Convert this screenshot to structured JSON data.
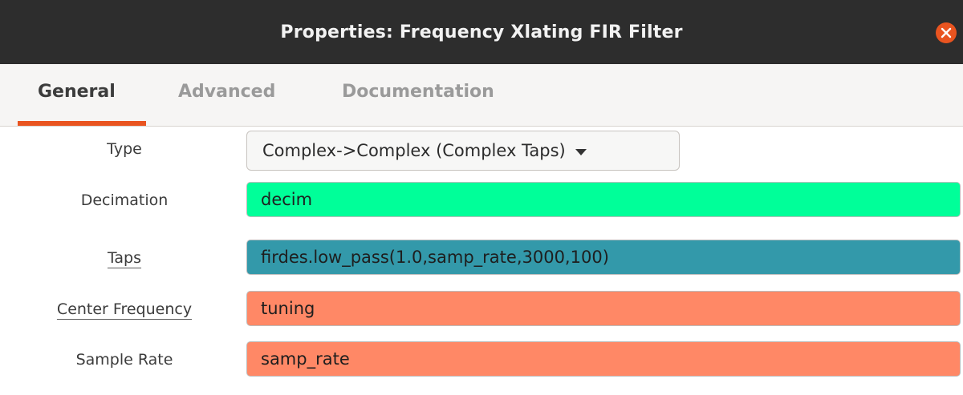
{
  "window": {
    "title": "Properties: Frequency Xlating FIR Filter",
    "close_icon": "close-icon"
  },
  "tabs": [
    {
      "label": "General",
      "active": true
    },
    {
      "label": "Advanced",
      "active": false
    },
    {
      "label": "Documentation",
      "active": false
    }
  ],
  "colors": {
    "accent": "#e95420",
    "titlebar": "#2d2d2d",
    "decimation_bg": "#00ff99",
    "taps_bg": "#3399aa",
    "center_freq_bg": "#ff8866",
    "sample_rate_bg": "#ff8866"
  },
  "fields": {
    "type": {
      "label": "Type",
      "value": "Complex->Complex (Complex Taps)"
    },
    "decimation": {
      "label": "Decimation",
      "value": "decim"
    },
    "taps": {
      "label": "Taps",
      "value": "firdes.low_pass(1.0,samp_rate,3000,100)"
    },
    "center_frequency": {
      "label": "Center Frequency",
      "value": "tuning"
    },
    "sample_rate": {
      "label": "Sample Rate",
      "value": "samp_rate"
    }
  }
}
